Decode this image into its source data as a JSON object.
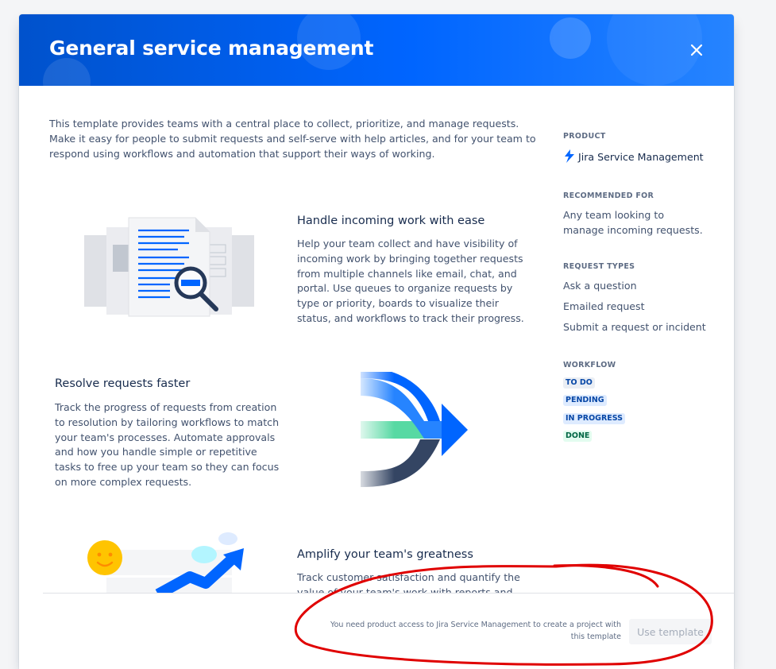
{
  "dialog": {
    "title": "General service management",
    "close_label": "Close"
  },
  "intro": "This template provides teams with a central place to collect, prioritize, and manage requests. Make it easy for people to submit requests and self-serve with help articles, and for your team to respond using workflows and automation that support their ways of working.",
  "features": [
    {
      "title": "Handle incoming work with ease",
      "text": "Help your team collect and have visibility of incoming work by bringing together requests from multiple channels like email, chat, and portal. Use queues to organize requests by type or priority, boards to visualize their status, and workflows to track their progress."
    },
    {
      "title": "Resolve requests faster",
      "text": "Track the progress of requests from creation to resolution by tailoring workflows to match your team's processes. Automate approvals and how you handle simple or repetitive tasks to free up your team so they can focus on more complex requests."
    },
    {
      "title": "Amplify your team's greatness",
      "text": "Track customer satisfaction and quantify the value of your team's work with reports and dashboards."
    }
  ],
  "sidebar": {
    "product_label": "PRODUCT",
    "product_name": "Jira Service Management",
    "recommended_label": "RECOMMENDED FOR",
    "recommended_text": "Any team looking to manage incoming requests.",
    "request_types_label": "REQUEST TYPES",
    "request_types": [
      "Ask a question",
      "Emailed request",
      "Submit a request or incident"
    ],
    "workflow_label": "WORKFLOW",
    "workflow": [
      "TO DO",
      "PENDING",
      "IN PROGRESS",
      "DONE"
    ]
  },
  "footer": {
    "note": "You need product access to Jira Service Management to create a project with this template",
    "button_label": "Use template"
  },
  "colors": {
    "header_start": "#0052cc",
    "header_end": "#2684ff",
    "annotation": "#e00000"
  }
}
